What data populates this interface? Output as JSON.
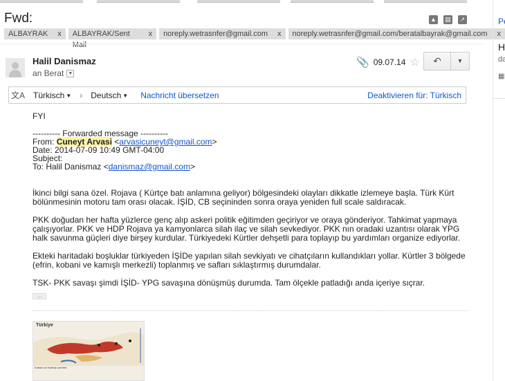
{
  "email": {
    "subject": "Fwd:",
    "labels": [
      {
        "name": "ALBAYRAK",
        "remove": "x"
      },
      {
        "name": "ALBAYRAK/Sent Mail",
        "remove": "x"
      },
      {
        "name": "noreply.wetrasnfer@gmail.com",
        "remove": "x"
      },
      {
        "name": "noreply.wetrasnfer@gmail.com/beratalbayrak@gmail.com",
        "remove": "x"
      }
    ],
    "sender": "Halil Danismaz",
    "to": "an Berat",
    "date": "09.07.14",
    "icons": {
      "print": "print-icon",
      "new_window": "new-window-icon",
      "collapse": "collapse-icon",
      "attachment": "paperclip-icon",
      "star": "star-icon",
      "reply": "reply-icon",
      "more": "chevron-down-icon",
      "translate": "translate-icon"
    }
  },
  "translate_bar": {
    "from": "Türkisch",
    "to": "Deutsch",
    "translate": "Nachricht übersetzen",
    "disable": "Deaktivieren für: Türkisch"
  },
  "body": {
    "fyi": "FYI",
    "fwd_header": "---------- Forwarded message ----------",
    "from_label": "From:",
    "from_name": "Cuneyt Arvasi",
    "from_email": "arvasicuneyt@gmail.com",
    "date_line": "Date: 2014-07-09 10:49 GMT-04:00",
    "subject_line": "Subject:",
    "to_label": "To: Halil Danismaz",
    "to_email": "danismaz@gmail.com",
    "paragraphs": [
      "İkinci bilgi sana özel. Rojava ( Kürtçe batı anlamına geliyor) bölgesindeki olayları dikkatle izlemeye başla. Türk Kürt bölünmesinin motoru tam orası olacak. İŞİD, CB seçininden sonra oraya yeniden full scale saldıracak.",
      "PKK doğudan her hafta yüzlerce genç alıp askeri politik eğitimden geçiriyor ve oraya gönderiyor. Tahkimat yapmaya çalışıyorlar. PKK ve HDP Rojava ya kamyonlarca silah ilaç ve silah sevkediyor. PKK nın oradaki uzantısı olarak YPG halk savunma güçleri diye birşey kurdular. Türkiyedeki Kürtler dehşetli para toplayıp bu yardımları organize ediyorlar.",
      "Ekteki haritadaki boşluklar türkiyeden İŞİDe yapılan silah sevkiyatı ve cihatçıların kullandıkları yollar. Kürtler 3 bölgede (efrin, kobani ve kamışlı merkezli) toplanmış ve safları sıklaştırmış durumdalar.",
      "TSK- PKK savaşı şimdi İŞİD- YPG savaşına dönüşmüş durumda. Tam ölçekle patladığı anda içeriye sıçrar."
    ],
    "ellipsis": "..."
  },
  "attachment_map": {
    "title": "Türkiye",
    "caption1": "Kobani ve Kamışlı çevresi",
    "caption2": ""
  },
  "right_panel": {
    "line1": "Pe",
    "line2": "H",
    "line3": "da"
  },
  "colors": {
    "link": "#1155cc",
    "label_bg": "#dddddd",
    "highlight": "#fff3a5",
    "map_red": "#c0392b",
    "map_blue": "#3a6fb0"
  }
}
